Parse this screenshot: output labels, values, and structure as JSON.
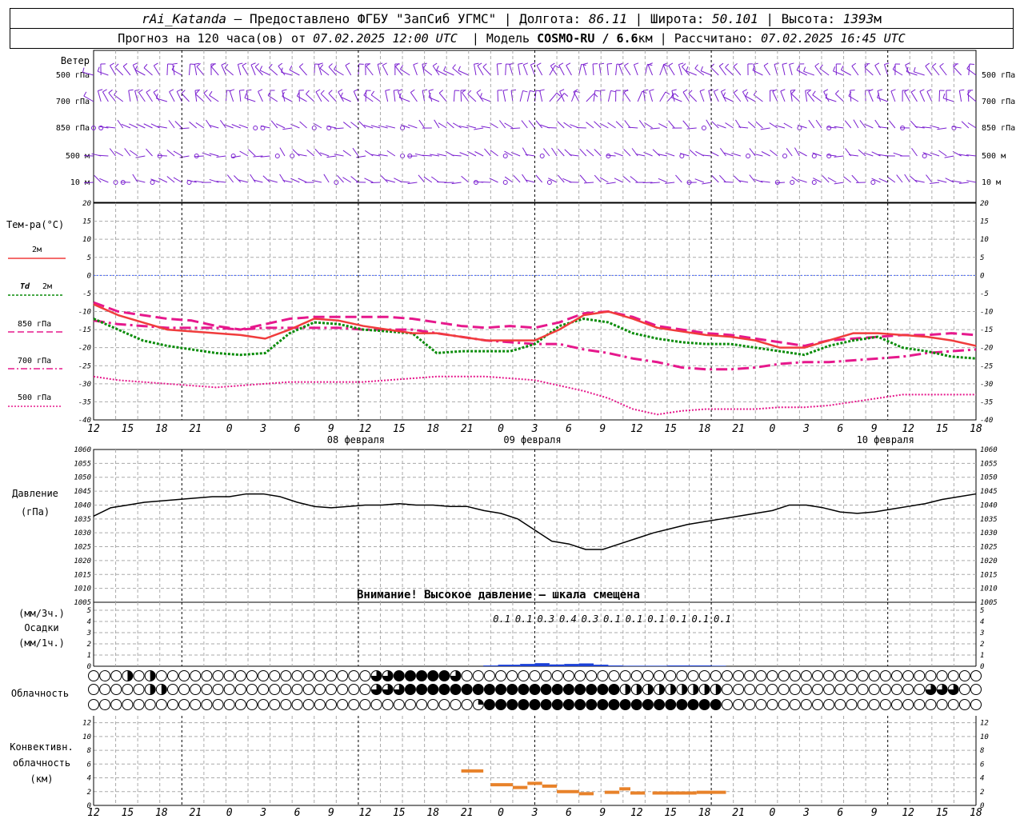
{
  "header": {
    "station": "rAi_Katanda",
    "provided": "Предоставлено ФГБУ \"ЗапСиб УГМС\"",
    "lon_label": "Долгота:",
    "lon": "86.11",
    "lat_label": "Широта:",
    "lat": "50.101",
    "alt_label": "Высота:",
    "alt": "1393",
    "alt_unit": "м",
    "forecast_label": "Прогноз на 120 часа(ов) от",
    "forecast_from": "07.02.2025 12:00 UTC",
    "model_label": "Модель",
    "model": "COSMO-RU / 6.6",
    "model_unit": "км",
    "calc_label": "Рассчитано:",
    "calc_time": "07.02.2025 16:45 UTC"
  },
  "colors": {
    "t2m": "#f03c3c",
    "td2m": "#0a8c0a",
    "t850": "#e6188c",
    "t700": "#e6188c",
    "t500": "#e6188c",
    "wind": "#7a1fd0",
    "pressure": "#000000",
    "precip": "#1a3fd6",
    "conv": "#e8822a",
    "zero": "#4466ff"
  },
  "chart_data": [
    {
      "type": "wind",
      "title": "Ветер",
      "levels": [
        "500 гПа",
        "700 гПа",
        "850 гПа",
        "500 м",
        "10  м"
      ]
    },
    {
      "type": "line",
      "title": "Тем-ра(°C)",
      "ylim": [
        -40,
        20
      ],
      "yticks": [
        20,
        15,
        10,
        5,
        0,
        -5,
        -10,
        -15,
        -20,
        -25,
        -30,
        -35,
        -40
      ],
      "x_hours": [
        0,
        3,
        6,
        9,
        12,
        15,
        18,
        21,
        24,
        27,
        30,
        33,
        36,
        39,
        42,
        45,
        48,
        51,
        54,
        57,
        60,
        63,
        66,
        69,
        72,
        75,
        78,
        81,
        84,
        87,
        90,
        93,
        96,
        99,
        102,
        105,
        108,
        111,
        114,
        117,
        120
      ],
      "xtick_labels": [
        "12",
        "15",
        "18",
        "21",
        "0",
        "3",
        "6",
        "9",
        "12",
        "15",
        "18",
        "21",
        "0",
        "3",
        "6",
        "9",
        "12",
        "15",
        "18",
        "21",
        "0",
        "3",
        "6",
        "9",
        "12",
        "15",
        "18"
      ],
      "date_labels": [
        "08 февраля",
        "09 февраля",
        "10 февраля"
      ],
      "series": [
        {
          "name": "2м",
          "values": [
            -8,
            -11,
            -13,
            -15,
            -15.5,
            -16,
            -16.5,
            -17.5,
            -15,
            -12,
            -12.5,
            -14,
            -15,
            -16,
            -16,
            -17,
            -18,
            -18,
            -18,
            -15,
            -11,
            -10,
            -12,
            -14.5,
            -15.5,
            -16.5,
            -17,
            -18,
            -20,
            -20,
            -18,
            -16,
            -16,
            -16.5,
            -17,
            -18,
            -19.5
          ]
        },
        {
          "name": "Td 2м",
          "values": [
            -12,
            -15,
            -18,
            -19.5,
            -20.5,
            -21.5,
            -22,
            -21.5,
            -16,
            -13,
            -13.5,
            -15,
            -15.5,
            -16,
            -21.5,
            -21,
            -21,
            -21,
            -19,
            -14,
            -12,
            -13,
            -16,
            -17.5,
            -18.5,
            -19,
            -19,
            -20,
            -21,
            -22,
            -19.5,
            -18,
            -17,
            -20,
            -21,
            -22.5,
            -23
          ]
        },
        {
          "name": "850 гПа",
          "values": [
            -7.5,
            -10,
            -11,
            -12,
            -12.5,
            -14,
            -15,
            -13.5,
            -12,
            -11.5,
            -11.5,
            -11.5,
            -11.5,
            -12,
            -13,
            -14,
            -14.5,
            -14,
            -14.5,
            -13,
            -10.5,
            -10,
            -11.5,
            -14,
            -15,
            -16,
            -16.5,
            -17.5,
            -18.5,
            -19.5,
            -18,
            -17.5,
            -17,
            -16.5,
            -16.5,
            -16,
            -16.5
          ]
        },
        {
          "name": "700 гПа",
          "values": [
            -12.5,
            -13.5,
            -14,
            -14.5,
            -14.5,
            -14.5,
            -15,
            -14.5,
            -14.5,
            -14.5,
            -14.5,
            -15,
            -15,
            -15,
            -16,
            -17,
            -18,
            -18.5,
            -19,
            -19,
            -20.5,
            -21.5,
            -23,
            -24,
            -25.5,
            -26,
            -26,
            -25.5,
            -24.5,
            -24,
            -24,
            -23.5,
            -23,
            -22.5,
            -21.5,
            -21,
            -20.5
          ]
        },
        {
          "name": "500 гПа",
          "values": [
            -28,
            -29,
            -29.5,
            -30,
            -30.5,
            -31,
            -30.5,
            -30,
            -29.5,
            -29.5,
            -29.5,
            -29.5,
            -29,
            -28.5,
            -28,
            -28,
            -28,
            -28.5,
            -29,
            -30.5,
            -32,
            -34,
            -37,
            -38.5,
            -37.5,
            -37,
            -37,
            -37,
            -36.5,
            -36.5,
            -36,
            -35,
            -34,
            -33,
            -33,
            -33,
            -33
          ]
        }
      ]
    },
    {
      "type": "line",
      "title": "Давление",
      "ylabel": "(гПа)",
      "ylim": [
        1005,
        1060
      ],
      "yticks": [
        1060,
        1055,
        1050,
        1045,
        1040,
        1035,
        1030,
        1025,
        1020,
        1015,
        1010,
        1005
      ],
      "series": [
        {
          "name": "",
          "values": [
            1036,
            1039,
            1040,
            1041,
            1041.5,
            1042,
            1042.5,
            1043,
            1043,
            1044,
            1044,
            1043,
            1041,
            1039.5,
            1039,
            1039.5,
            1040,
            1040,
            1040.5,
            1040,
            1040,
            1039.5,
            1039.5,
            1038,
            1037,
            1035,
            1031,
            1027,
            1026,
            1024,
            1024,
            1026,
            1028,
            1030,
            1031.5,
            1033,
            1034,
            1035,
            1036,
            1037,
            1038,
            1040,
            1040,
            1039,
            1037.5,
            1037,
            1037.5,
            1038.5,
            1039.5,
            1040.5,
            1042,
            1043,
            1044
          ]
        }
      ],
      "note": "Внимание! Высокое давление - шкала смещена"
    },
    {
      "type": "bar",
      "title": "Осадки",
      "ylabel_top": "(мм/3ч.)",
      "ylabel_bottom": "(мм/1ч.)",
      "ylim": [
        0,
        5
      ],
      "yticks": [
        5,
        4,
        3,
        2,
        1,
        0
      ],
      "labels_3h": [
        {
          "hour": 54,
          "value": "0.1"
        },
        {
          "hour": 57,
          "value": "0.1"
        },
        {
          "hour": 60,
          "value": "0.3"
        },
        {
          "hour": 63,
          "value": "0.4"
        },
        {
          "hour": 66,
          "value": "0.3"
        },
        {
          "hour": 69,
          "value": "0.1"
        },
        {
          "hour": 72,
          "value": "0.1"
        },
        {
          "hour": 75,
          "value": "0.1"
        },
        {
          "hour": 78,
          "value": "0.1"
        },
        {
          "hour": 81,
          "value": "0.1"
        },
        {
          "hour": 84,
          "value": "0.1"
        }
      ]
    },
    {
      "type": "table",
      "title": "Облачность",
      "rows": 3
    },
    {
      "type": "bar",
      "title": "Конвективн. облачность",
      "ylabel": "(км)",
      "ylim": [
        0,
        13
      ],
      "yticks": [
        12,
        10,
        8,
        6,
        4,
        2,
        0
      ],
      "segments": [
        {
          "h0": 50,
          "h1": 53,
          "value": 5
        },
        {
          "h0": 54,
          "h1": 57,
          "value": 3
        },
        {
          "h0": 57,
          "h1": 59,
          "value": 2.6
        },
        {
          "h0": 59,
          "h1": 61,
          "value": 3.2
        },
        {
          "h0": 61,
          "h1": 63,
          "value": 2.8
        },
        {
          "h0": 63,
          "h1": 66,
          "value": 2
        },
        {
          "h0": 66,
          "h1": 68,
          "value": 1.7
        },
        {
          "h0": 69.5,
          "h1": 71.5,
          "value": 1.9
        },
        {
          "h0": 71.5,
          "h1": 73,
          "value": 2.4
        },
        {
          "h0": 73,
          "h1": 75,
          "value": 1.8
        },
        {
          "h0": 76,
          "h1": 82,
          "value": 1.8
        },
        {
          "h0": 82,
          "h1": 86,
          "value": 1.9
        }
      ]
    }
  ],
  "labels": {
    "wind": "Ветер",
    "temp": "Тем-ра(°C)",
    "l2m": "2м",
    "ltd": "Td",
    "ltd2": "2м",
    "l850": "850 гПа",
    "l700": "700 гПа",
    "l500": "500 гПа",
    "pressure": "Давление",
    "pressure_unit": "(гПа)",
    "pressure_note": "Внимание! Высокое давление — шкала смещена",
    "precip_top": "(мм/3ч.)",
    "precip": "Осадки",
    "precip_bottom": "(мм/1ч.)",
    "cloud": "Облачность",
    "conv1": "Конвективн.",
    "conv2": "облачность",
    "conv3": "(км)"
  }
}
